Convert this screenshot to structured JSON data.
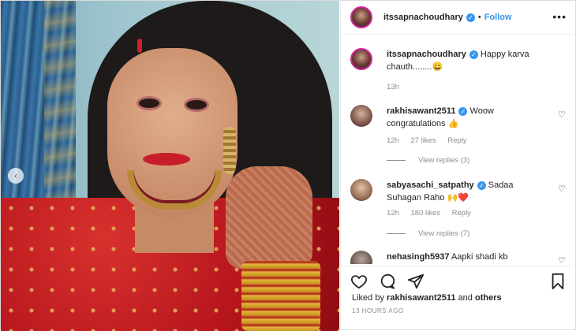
{
  "post": {
    "author": "itssapnachoudhary",
    "follow_label": "Follow",
    "dot": "•",
    "more": "•••",
    "caption_author": "itssapnachoudhary",
    "caption_text": "Happy karva chauth........😀",
    "caption_time": "13h",
    "liked_prefix": "Liked by",
    "liked_user": "rakhisawant2511",
    "liked_and": "and",
    "liked_others": "others",
    "timestamp": "13 HOURS AGO"
  },
  "comments": [
    {
      "user": "rakhisawant2511",
      "text": "Woow congratulations 👍",
      "time": "12h",
      "likes": "27 likes",
      "reply": "Reply",
      "view_replies": "View replies (3)",
      "verified": true
    },
    {
      "user": "sabyasachi_satpathy",
      "text": "Sadaa Suhagan Raho 🙌❤️",
      "time": "12h",
      "likes": "180 likes",
      "reply": "Reply",
      "view_replies": "View replies (7)",
      "verified": true
    },
    {
      "user": "nehasingh5937",
      "text": "Aapki shadi kb",
      "verified": false
    }
  ],
  "icons": {
    "heart": "heart-icon",
    "comment": "comment-icon",
    "share": "share-icon",
    "bookmark": "bookmark-icon",
    "verified": "verified-badge-icon",
    "prev": "chevron-left-icon"
  },
  "colors": {
    "link_blue": "#3897f0",
    "text": "#262626",
    "muted": "#8e8e8e"
  }
}
